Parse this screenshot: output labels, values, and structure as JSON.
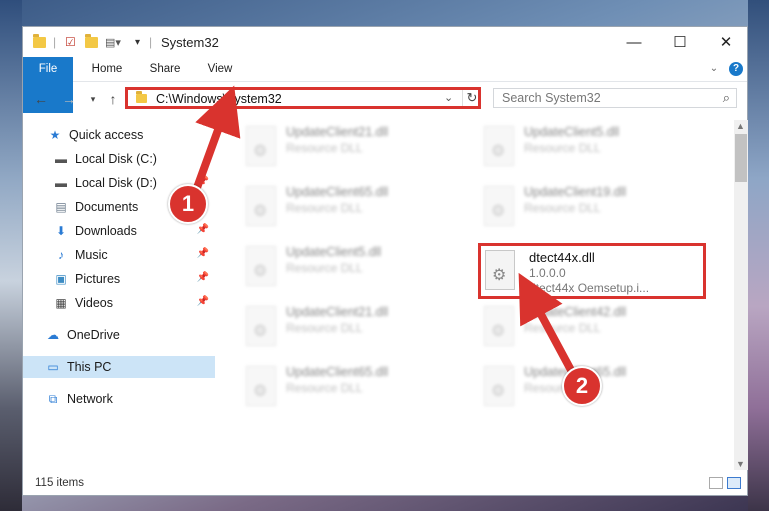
{
  "window": {
    "title": "System32",
    "controls": {
      "minimize": "—",
      "maximize": "☐",
      "close": "✕"
    }
  },
  "ribbon": {
    "tabs": [
      "File",
      "Home",
      "Share",
      "View"
    ],
    "help": "?"
  },
  "address": {
    "path": "C:\\Windows\\System32",
    "search_placeholder": "Search System32"
  },
  "sidebar": {
    "items": [
      {
        "label": "Quick access",
        "icon": "star-icon"
      },
      {
        "label": "Local Disk (C:)",
        "icon": "drive-icon"
      },
      {
        "label": "Local Disk (D:)",
        "icon": "drive-icon"
      },
      {
        "label": "Documents",
        "icon": "documents-icon"
      },
      {
        "label": "Downloads",
        "icon": "download-icon"
      },
      {
        "label": "Music",
        "icon": "music-icon"
      },
      {
        "label": "Pictures",
        "icon": "pictures-icon"
      },
      {
        "label": "Videos",
        "icon": "videos-icon"
      },
      {
        "label": "OneDrive",
        "icon": "cloud-icon"
      },
      {
        "label": "This PC",
        "icon": "computer-icon"
      },
      {
        "label": "Network",
        "icon": "network-icon"
      }
    ]
  },
  "files": [
    {
      "name": "UpdateClient21.dll",
      "type": "Resource DLL"
    },
    {
      "name": "UpdateClient5.dll",
      "type": "Resource DLL"
    },
    {
      "name": "UpdateClient65.dll",
      "type": "Resource DLL"
    },
    {
      "name": "UpdateClient19.dll",
      "type": "Resource DLL"
    },
    {
      "name": "UpdateClient5.dll",
      "type": "Resource DLL"
    },
    {
      "name": "UpdateClient21.dll",
      "type": "Resource DLL"
    },
    {
      "name": "UpdateClient42.dll",
      "type": "Resource DLL"
    },
    {
      "name": "UpdateClient65.dll",
      "type": "Resource DLL"
    },
    {
      "name": "UpdateClient65.dll",
      "type": "Resource DLL"
    }
  ],
  "highlighted_file": {
    "name": "dtect44x.dll",
    "version": "1.0.0.0",
    "description": "dtect44x Oemsetup.i..."
  },
  "status": {
    "items": "115 items"
  },
  "annotations": {
    "step1": "1",
    "step2": "2",
    "color": "#d9332e"
  }
}
